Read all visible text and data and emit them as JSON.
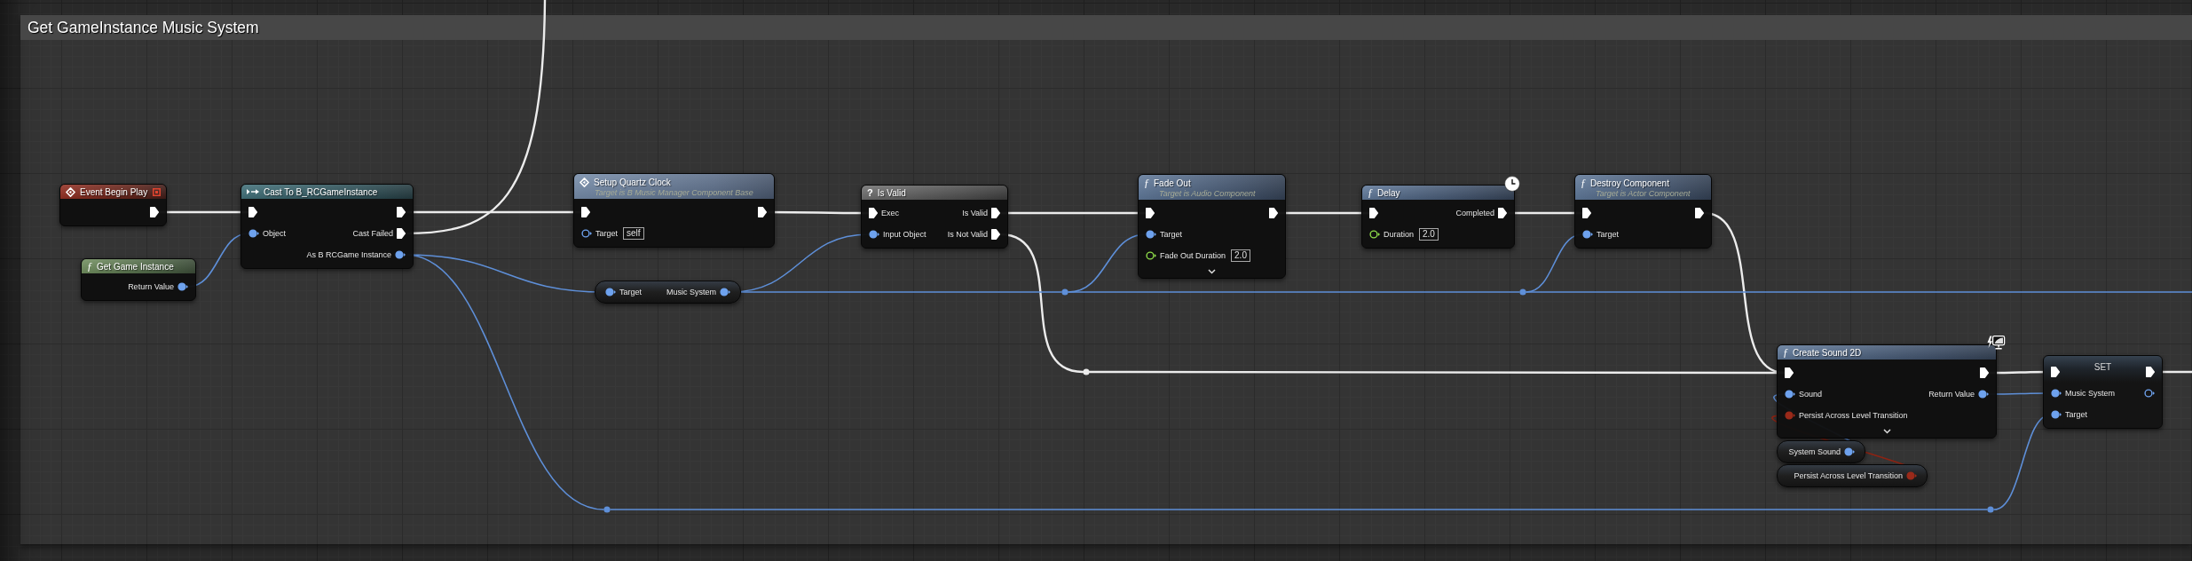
{
  "comment": {
    "title": "Get GameInstance Music System"
  },
  "nodes": [
    {
      "kind": "event",
      "title": "Event Begin Play",
      "delegate_pin": true,
      "rows": [
        {
          "out": {
            "kind": "exec",
            "connected": true
          }
        }
      ]
    },
    {
      "kind": "cast",
      "title": "Cast To B_RCGameInstance",
      "rows": [
        {
          "in": {
            "kind": "exec",
            "connected": true
          },
          "out": {
            "kind": "exec",
            "connected": true
          }
        },
        {
          "in": {
            "kind": "object",
            "label": "Object",
            "connected": true
          },
          "out": {
            "kind": "exec",
            "label": "Cast Failed",
            "connected": true
          }
        },
        {
          "out": {
            "kind": "object",
            "label": "As B RCGame Instance",
            "connected": true
          }
        }
      ]
    },
    {
      "kind": "pure_function",
      "glyph": "ƒ",
      "title": "Get Game Instance",
      "rows": [
        {
          "out": {
            "kind": "object",
            "label": "Return Value",
            "connected": true
          }
        }
      ]
    },
    {
      "kind": "event_call",
      "title": "Setup Quartz Clock",
      "subtitle": "Target is B Music Manager Component Base",
      "rows": [
        {
          "in": {
            "kind": "exec",
            "connected": true
          },
          "out": {
            "kind": "exec",
            "connected": true
          }
        },
        {
          "in": {
            "kind": "object",
            "label": "Target",
            "connected": false,
            "value": "self"
          }
        }
      ]
    },
    {
      "kind": "macro",
      "glyph": "?",
      "title": "Is Valid",
      "rows": [
        {
          "in": {
            "kind": "exec",
            "label": "Exec",
            "connected": true
          },
          "out": {
            "kind": "exec",
            "label": "Is Valid",
            "connected": true
          }
        },
        {
          "in": {
            "kind": "object",
            "label": "Input Object",
            "connected": true
          },
          "out": {
            "kind": "exec",
            "label": "Is Not Valid",
            "connected": true
          }
        }
      ]
    },
    {
      "kind": "variable",
      "rows": [
        {
          "in": {
            "kind": "object",
            "label": "Target",
            "connected": true
          },
          "out": {
            "kind": "object",
            "label": "Music System",
            "connected": true
          }
        }
      ]
    },
    {
      "kind": "function",
      "glyph": "ƒ",
      "title": "Fade Out",
      "subtitle": "Target is Audio Component",
      "advanced_collapsed": true,
      "rows": [
        {
          "in": {
            "kind": "exec",
            "connected": true
          },
          "out": {
            "kind": "exec",
            "connected": true
          }
        },
        {
          "in": {
            "kind": "object",
            "label": "Target",
            "connected": true
          }
        },
        {
          "in": {
            "kind": "float",
            "label": "Fade Out Duration",
            "connected": false,
            "value": "2.0"
          }
        }
      ]
    },
    {
      "kind": "function",
      "glyph": "ƒ",
      "title": "Delay",
      "latent": true,
      "rows": [
        {
          "in": {
            "kind": "exec",
            "connected": true
          },
          "out": {
            "kind": "exec",
            "label": "Completed",
            "connected": true
          }
        },
        {
          "in": {
            "kind": "float",
            "label": "Duration",
            "connected": false,
            "value": "2.0"
          }
        }
      ]
    },
    {
      "kind": "function",
      "glyph": "ƒ",
      "title": "Destroy Component",
      "subtitle": "Target is Actor Component",
      "rows": [
        {
          "in": {
            "kind": "exec",
            "connected": true
          },
          "out": {
            "kind": "exec",
            "connected": true
          }
        },
        {
          "in": {
            "kind": "object",
            "label": "Target",
            "connected": true
          }
        }
      ]
    },
    {
      "kind": "function",
      "glyph": "ƒ",
      "title": "Create Sound 2D",
      "cosmetic": true,
      "advanced_collapsed": true,
      "rows": [
        {
          "in": {
            "kind": "exec",
            "connected": true
          },
          "out": {
            "kind": "exec",
            "connected": true
          }
        },
        {
          "in": {
            "kind": "object",
            "label": "Sound",
            "connected": true
          },
          "out": {
            "kind": "object",
            "label": "Return Value",
            "connected": true
          }
        },
        {
          "in": {
            "kind": "bool",
            "label": "Persist Across Level Transition",
            "connected": true
          }
        }
      ]
    },
    {
      "kind": "set",
      "title": "SET",
      "rows": [
        {
          "in": {
            "kind": "exec",
            "connected": true
          },
          "out": {
            "kind": "exec",
            "connected": true
          }
        },
        {
          "in": {
            "kind": "object",
            "label": "Music System",
            "connected": true
          },
          "out": {
            "kind": "object",
            "connected": false
          }
        },
        {
          "in": {
            "kind": "object",
            "label": "Target",
            "connected": true
          }
        }
      ]
    },
    {
      "kind": "variable",
      "rows": [
        {
          "out": {
            "kind": "object",
            "label": "System Sound",
            "connected": true
          }
        }
      ]
    },
    {
      "kind": "variable",
      "rows": [
        {
          "out": {
            "kind": "bool",
            "label": "Persist Across Level Transition",
            "connected": true
          }
        }
      ]
    }
  ]
}
